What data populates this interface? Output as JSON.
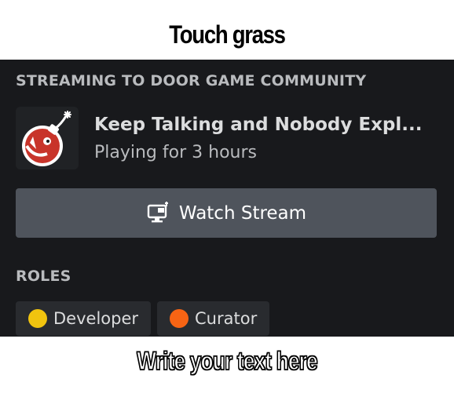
{
  "captions": {
    "top": "Touch grass",
    "bottom": "Write your text here"
  },
  "profile_popout": {
    "activity_heading": "STREAMING TO DOOR GAME COMMUNITY",
    "game": {
      "title": "Keep Talking and Nobody Expl...",
      "subtitle": "Playing for 3 hours",
      "icon": "bomb-icon"
    },
    "watch_button": {
      "label": "Watch Stream",
      "icon": "screen-share-icon"
    },
    "roles_heading": "ROLES",
    "roles": [
      {
        "name": "Developer",
        "color": "#f1c40f"
      },
      {
        "name": "Curator",
        "color": "#f76414"
      }
    ]
  },
  "colors": {
    "panel_background": "#18191c",
    "button_background": "#4f545c",
    "chip_background": "#292b2f",
    "heading_text": "#b9bbbe",
    "primary_text": "#dcddde"
  }
}
